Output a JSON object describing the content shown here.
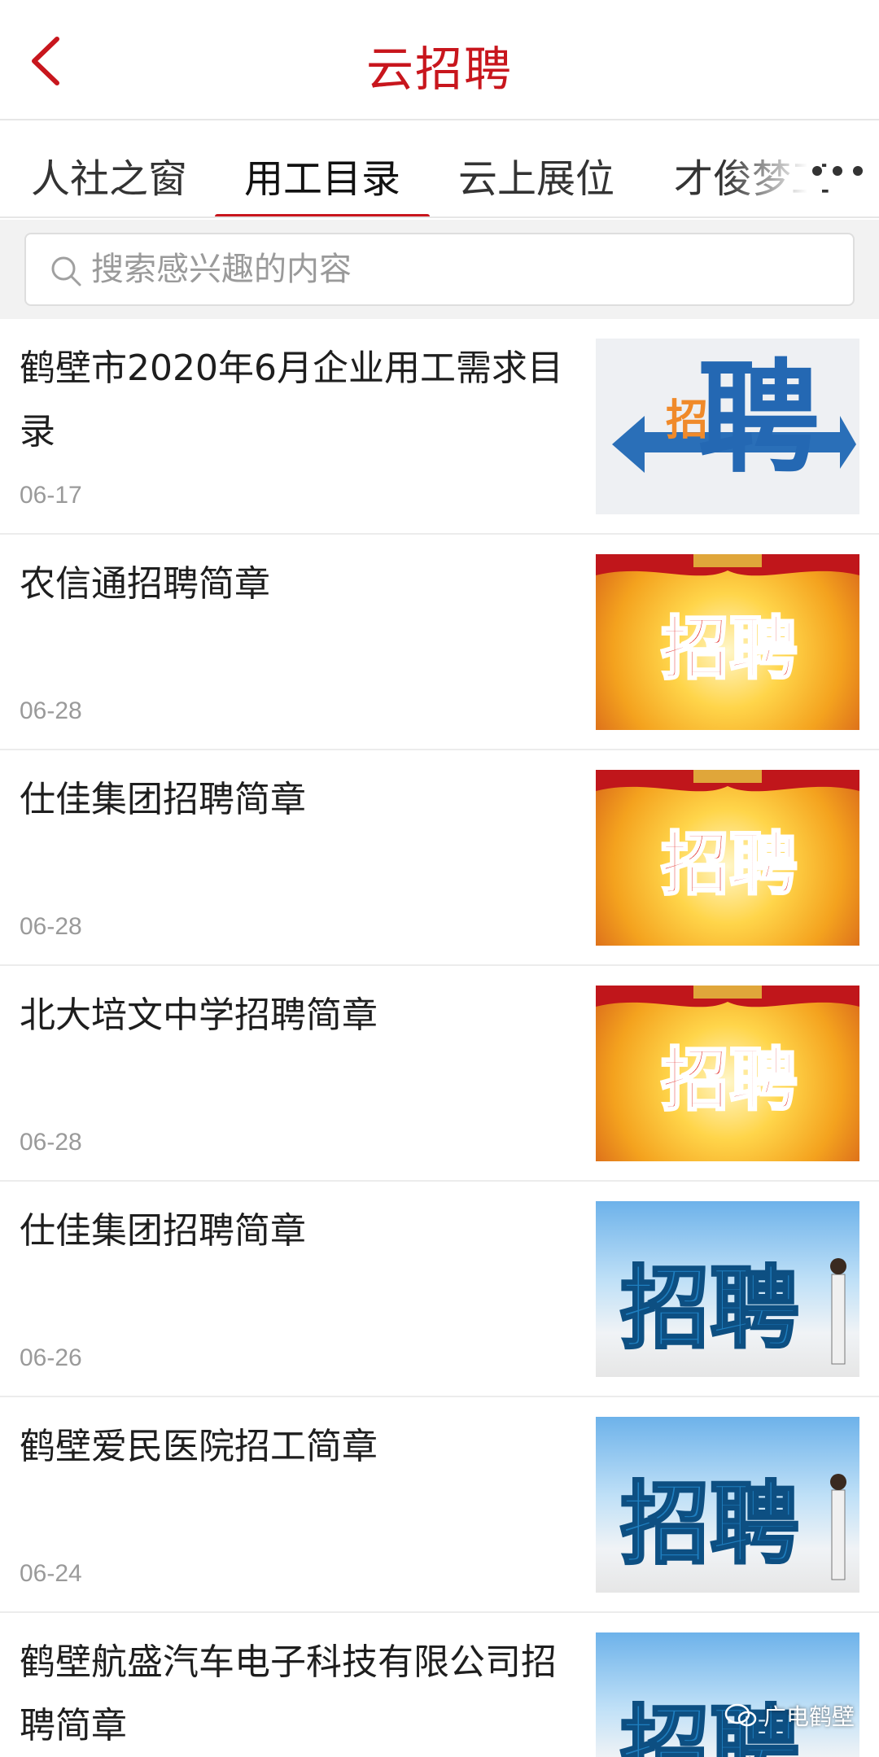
{
  "header": {
    "title": "云招聘"
  },
  "tabs": [
    {
      "label": "人社之窗"
    },
    {
      "label": "用工目录"
    },
    {
      "label": "云上展位"
    },
    {
      "label": "才俊梦工"
    }
  ],
  "search": {
    "placeholder": "搜索感兴趣的内容"
  },
  "items": [
    {
      "title": "鹤壁市2020年6月企业用工需求目录",
      "date": "06-17"
    },
    {
      "title": "农信通招聘简章",
      "date": "06-28"
    },
    {
      "title": "仕佳集团招聘简章",
      "date": "06-28"
    },
    {
      "title": "北大培文中学招聘简章",
      "date": "06-28"
    },
    {
      "title": "仕佳集团招聘简章",
      "date": "06-26"
    },
    {
      "title": "鹤壁爱民医院招工简章",
      "date": "06-24"
    },
    {
      "title": "鹤壁航盛汽车电子科技有限公司招聘简章",
      "date": ""
    }
  ],
  "thumbnails": {
    "poster_text": "招聘",
    "small_text": "招",
    "big_text": "聘"
  },
  "watermark": "广电鹤壁",
  "colors": {
    "accent": "#c8161d",
    "muted": "#9a9a9a"
  }
}
